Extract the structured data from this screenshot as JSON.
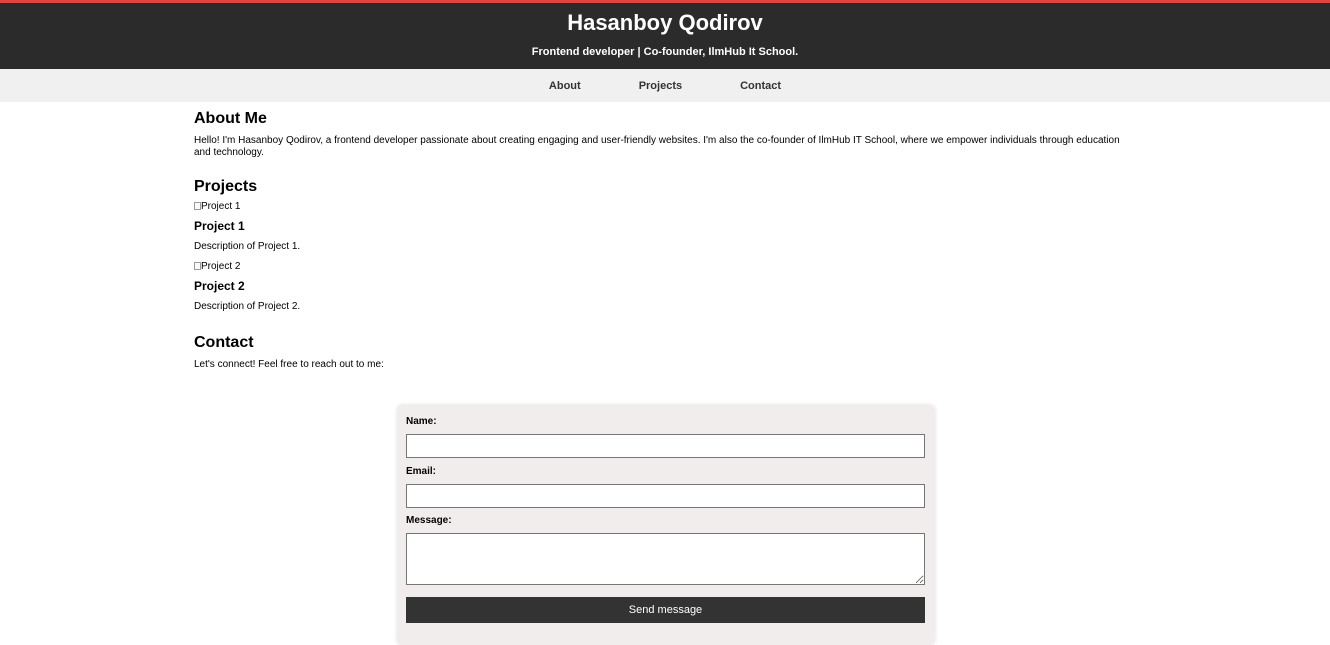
{
  "header": {
    "title": "Hasanboy Qodirov",
    "tagline": "Frontend developer | Co-founder, IlmHub It School.",
    "accent_color": "#e0443e",
    "background_color": "#2b2b2b"
  },
  "nav": {
    "items": [
      {
        "label": "About"
      },
      {
        "label": "Projects"
      },
      {
        "label": "Contact"
      }
    ]
  },
  "about": {
    "heading": "About Me",
    "text": "Hello! I'm Hasanboy Qodirov, a frontend developer passionate about creating engaging and user-friendly websites. I'm also the co-founder of IlmHub IT School, where we empower individuals through education and technology."
  },
  "projects": {
    "heading": "Projects",
    "items": [
      {
        "image_alt": "Project 1",
        "title": "Project 1",
        "description": "Description of Project 1."
      },
      {
        "image_alt": "Project 2",
        "title": "Project 2",
        "description": "Description of Project 2."
      }
    ]
  },
  "contact": {
    "heading": "Contact",
    "text": "Let's connect! Feel free to reach out to me:",
    "form": {
      "name_label": "Name:",
      "name_value": "",
      "email_label": "Email:",
      "email_value": "",
      "message_label": "Message:",
      "message_value": "",
      "submit_label": "Send message"
    }
  }
}
